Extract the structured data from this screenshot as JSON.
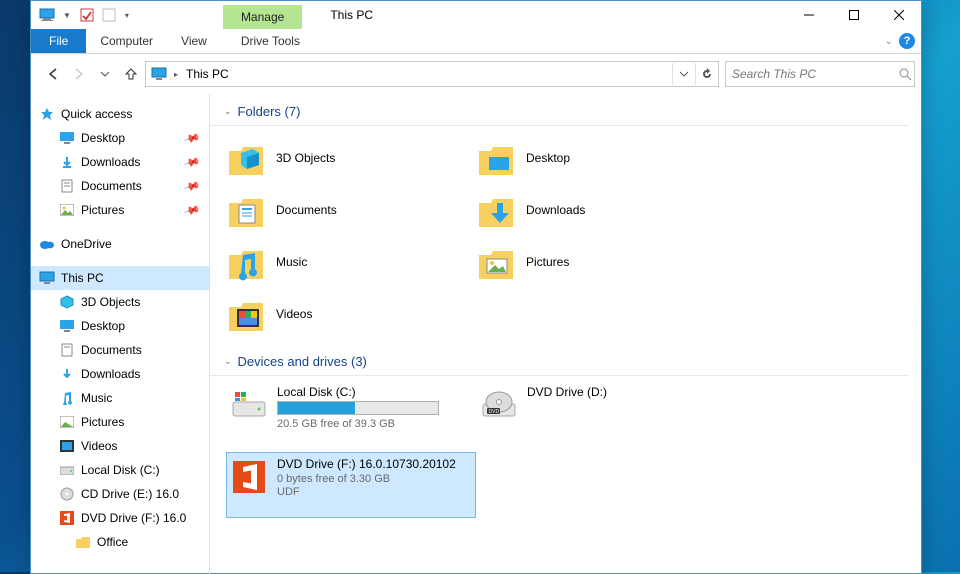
{
  "title": "This PC",
  "contextual_tab": "Manage",
  "contextual_group": "Drive Tools",
  "ribbon": {
    "file": "File",
    "computer": "Computer",
    "view": "View"
  },
  "address": {
    "crumb": "This PC"
  },
  "search": {
    "placeholder": "Search This PC"
  },
  "tree": {
    "quick": "Quick access",
    "desktop": "Desktop",
    "downloads": "Downloads",
    "documents": "Documents",
    "pictures": "Pictures",
    "onedrive": "OneDrive",
    "thispc": "This PC",
    "objects3d": "3D Objects",
    "desktop2": "Desktop",
    "documents2": "Documents",
    "downloads2": "Downloads",
    "music": "Music",
    "pictures2": "Pictures",
    "videos": "Videos",
    "localc": "Local Disk (C:)",
    "cde": "CD Drive (E:) 16.0",
    "dvf": "DVD Drive (F:) 16.0",
    "office": "Office"
  },
  "sections": {
    "folders": "Folders (7)",
    "drives": "Devices and drives (3)"
  },
  "folders": {
    "objects3d": "3D Objects",
    "desktop": "Desktop",
    "documents": "Documents",
    "downloads": "Downloads",
    "music": "Music",
    "pictures": "Pictures",
    "videos": "Videos"
  },
  "drives": {
    "c": {
      "name": "Local Disk (C:)",
      "sub": "20.5 GB free of 39.3 GB",
      "fill_pct": 48
    },
    "d": {
      "name": "DVD Drive (D:)"
    },
    "f": {
      "name": "DVD Drive (F:) 16.0.10730.20102",
      "sub1": "0 bytes free of 3.30 GB",
      "sub2": "UDF"
    }
  }
}
